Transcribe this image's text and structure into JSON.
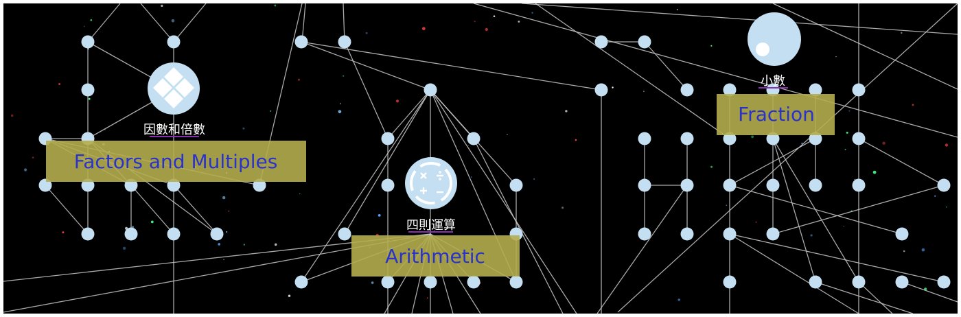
{
  "colors": {
    "background": "#000000",
    "node": "#c3dff1",
    "edge": "#c8c8c8",
    "label_box": "#b5ad4e",
    "label_text": "#2a33c9",
    "zh_label": "#ffffff",
    "zh_underline": "#8b2fb0"
  },
  "icons": {
    "factors": "diamond-grid-icon",
    "arithmetic": "operators-circle-icon",
    "fraction": "fraction-bubble-icon"
  },
  "skills": {
    "factors": {
      "zh_label": "因數和倍數",
      "en_label": "Factors and Multiples"
    },
    "arithmetic": {
      "zh_label": "四則運算",
      "en_label": "Arithmetic"
    },
    "fraction": {
      "zh_label": "小數",
      "en_label": "Fraction"
    }
  }
}
